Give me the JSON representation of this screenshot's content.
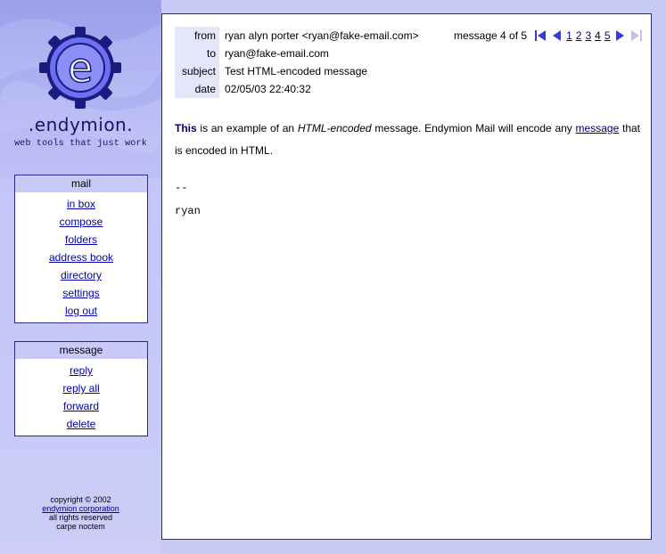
{
  "brand": {
    "name": ".endymion.",
    "tagline": "web tools that just work",
    "logo_icon": "gear-e-logo-icon"
  },
  "mail_panel": {
    "title": "mail",
    "items": [
      {
        "label": "in box"
      },
      {
        "label": "compose"
      },
      {
        "label": "folders"
      },
      {
        "label": "address book"
      },
      {
        "label": "directory"
      },
      {
        "label": "settings"
      },
      {
        "label": "log out"
      }
    ]
  },
  "message_panel": {
    "title": "message",
    "items": [
      {
        "label": "reply"
      },
      {
        "label": "reply all"
      },
      {
        "label": "forward"
      },
      {
        "label": "delete"
      }
    ]
  },
  "footer": {
    "line1": "copyright © 2002",
    "company": "endymion corporation",
    "line3": "all rights reserved",
    "line4": "carpe noctem"
  },
  "header": {
    "from_label": "from",
    "from_value": "ryan alyn porter <ryan@fake-email.com>",
    "to_label": "to",
    "to_value": "ryan@fake-email.com",
    "subject_label": "subject",
    "subject_value": "Test HTML-encoded message",
    "date_label": "date",
    "date_value": "02/05/03 22:40:32"
  },
  "pager": {
    "count_text": "message 4 of 5",
    "pages": [
      "1",
      "2",
      "3",
      "4",
      "5"
    ],
    "current_page": "4",
    "icons": [
      "first-page-icon",
      "prev-page-icon",
      "next-page-icon",
      "last-page-icon"
    ]
  },
  "message": {
    "bold_word": "This",
    "text1": " is an example of an ",
    "italic_phrase": "HTML-encoded",
    "text2": " message.  Endymion Mail will encode any ",
    "link_word": "message",
    "text3": " that is encoded in HTML.",
    "sig_dash": "--",
    "sig_name": "ryan"
  },
  "colors": {
    "sidebar_bg": "#c9c9f6",
    "link": "#0000a8",
    "border": "#2a2a8a",
    "label_bg": "#e6e6fa",
    "icon_blue": "#3a3adc"
  }
}
